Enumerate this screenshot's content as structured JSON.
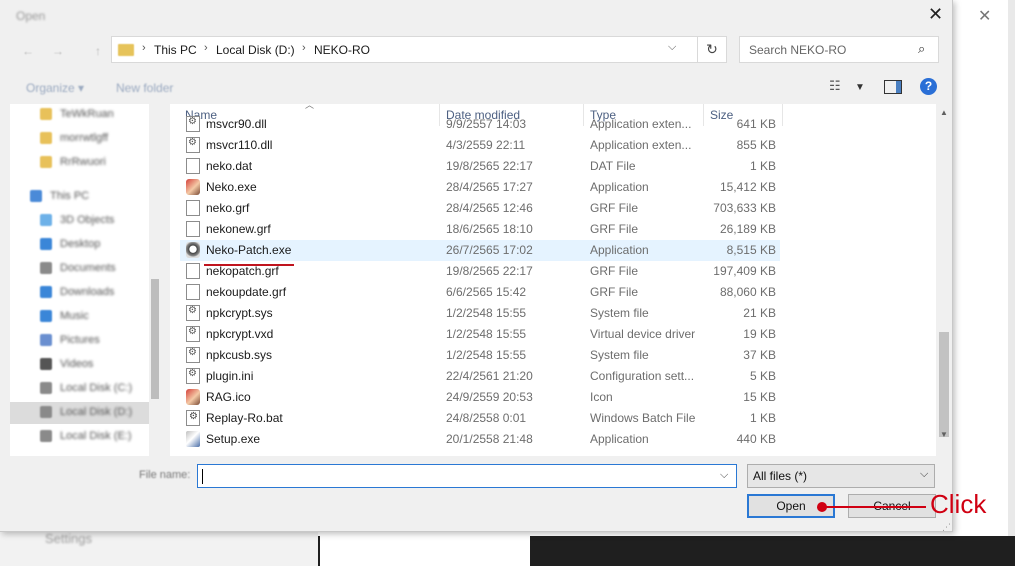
{
  "dialog": {
    "title": "Open",
    "close_glyph": "✕"
  },
  "nav": {
    "back": "←",
    "forward": "→",
    "up": "↑"
  },
  "address": {
    "crumbs": [
      "This PC",
      "Local Disk (D:)",
      "NEKO-RO"
    ],
    "separator": "›",
    "dropdown": "⌵",
    "refresh": "↻"
  },
  "search": {
    "placeholder": "Search NEKO-RO",
    "icon": "⌕"
  },
  "toolbar": {
    "organize": "Organize ▾",
    "new_folder": "New folder",
    "help": "?"
  },
  "navpane": {
    "items": [
      {
        "label": "TeWkRuan",
        "icon": "folder-icon",
        "color": "#e8c15a"
      },
      {
        "label": "morrwtlgff",
        "icon": "folder-icon",
        "color": "#e8c15a"
      },
      {
        "label": "RrRwuori",
        "icon": "folder-icon",
        "color": "#e8c15a"
      },
      {
        "label": "This PC",
        "icon": "computer-icon",
        "color": "#4a8ad8"
      },
      {
        "label": "3D Objects",
        "icon": "cube-icon",
        "color": "#6db1e8"
      },
      {
        "label": "Desktop",
        "icon": "desktop-icon",
        "color": "#3a86d8"
      },
      {
        "label": "Documents",
        "icon": "document-icon",
        "color": "#8a8a8a"
      },
      {
        "label": "Downloads",
        "icon": "download-icon",
        "color": "#3a86d8"
      },
      {
        "label": "Music",
        "icon": "music-icon",
        "color": "#3a86d8"
      },
      {
        "label": "Pictures",
        "icon": "picture-icon",
        "color": "#6a8fd0"
      },
      {
        "label": "Videos",
        "icon": "video-icon",
        "color": "#555555"
      },
      {
        "label": "Local Disk (C:)",
        "icon": "drive-icon",
        "color": "#8a8a8a"
      },
      {
        "label": "Local Disk (D:)",
        "icon": "drive-icon",
        "color": "#8a8a8a"
      },
      {
        "label": "Local Disk (E:)",
        "icon": "drive-icon",
        "color": "#8a8a8a"
      }
    ]
  },
  "columns": {
    "name": "Name",
    "date": "Date modified",
    "type": "Type",
    "size": "Size"
  },
  "files": [
    {
      "name": "msvcr90.dll",
      "date": "9/9/2557 14:03",
      "type": "Application exten...",
      "size": "641 KB",
      "icon": "gear"
    },
    {
      "name": "msvcr110.dll",
      "date": "4/3/2559 22:11",
      "type": "Application exten...",
      "size": "855 KB",
      "icon": "gear"
    },
    {
      "name": "neko.dat",
      "date": "19/8/2565 22:17",
      "type": "DAT File",
      "size": "1 KB",
      "icon": "doc"
    },
    {
      "name": "Neko.exe",
      "date": "28/4/2565 17:27",
      "type": "Application",
      "size": "15,412 KB",
      "icon": "app"
    },
    {
      "name": "neko.grf",
      "date": "28/4/2565 12:46",
      "type": "GRF File",
      "size": "703,633 KB",
      "icon": "doc"
    },
    {
      "name": "nekonew.grf",
      "date": "18/6/2565 18:10",
      "type": "GRF File",
      "size": "26,189 KB",
      "icon": "doc"
    },
    {
      "name": "Neko-Patch.exe",
      "date": "26/7/2565 17:02",
      "type": "Application",
      "size": "8,515 KB",
      "icon": "app2"
    },
    {
      "name": "nekopatch.grf",
      "date": "19/8/2565 22:17",
      "type": "GRF File",
      "size": "197,409 KB",
      "icon": "doc"
    },
    {
      "name": "nekoupdate.grf",
      "date": "6/6/2565 15:42",
      "type": "GRF File",
      "size": "88,060 KB",
      "icon": "doc"
    },
    {
      "name": "npkcrypt.sys",
      "date": "1/2/2548 15:55",
      "type": "System file",
      "size": "21 KB",
      "icon": "gear"
    },
    {
      "name": "npkcrypt.vxd",
      "date": "1/2/2548 15:55",
      "type": "Virtual device driver",
      "size": "19 KB",
      "icon": "gear"
    },
    {
      "name": "npkcusb.sys",
      "date": "1/2/2548 15:55",
      "type": "System file",
      "size": "37 KB",
      "icon": "gear"
    },
    {
      "name": "plugin.ini",
      "date": "22/4/2561 21:20",
      "type": "Configuration sett...",
      "size": "5 KB",
      "icon": "gear"
    },
    {
      "name": "RAG.ico",
      "date": "24/9/2559 20:53",
      "type": "Icon",
      "size": "15 KB",
      "icon": "app"
    },
    {
      "name": "Replay-Ro.bat",
      "date": "24/8/2558 0:01",
      "type": "Windows Batch File",
      "size": "1 KB",
      "icon": "bat"
    },
    {
      "name": "Setup.exe",
      "date": "20/1/2558 21:48",
      "type": "Application",
      "size": "440 KB",
      "icon": "setup"
    }
  ],
  "highlighted_row": 6,
  "footer": {
    "filename_label": "File name:",
    "filename_value": "",
    "filter": "All files (*)",
    "open": "Open",
    "cancel": "Cancel"
  },
  "annotation": {
    "text": "Click",
    "color": "#d00012"
  },
  "background": {
    "settings": "Settings",
    "close_glyph": "✕"
  }
}
